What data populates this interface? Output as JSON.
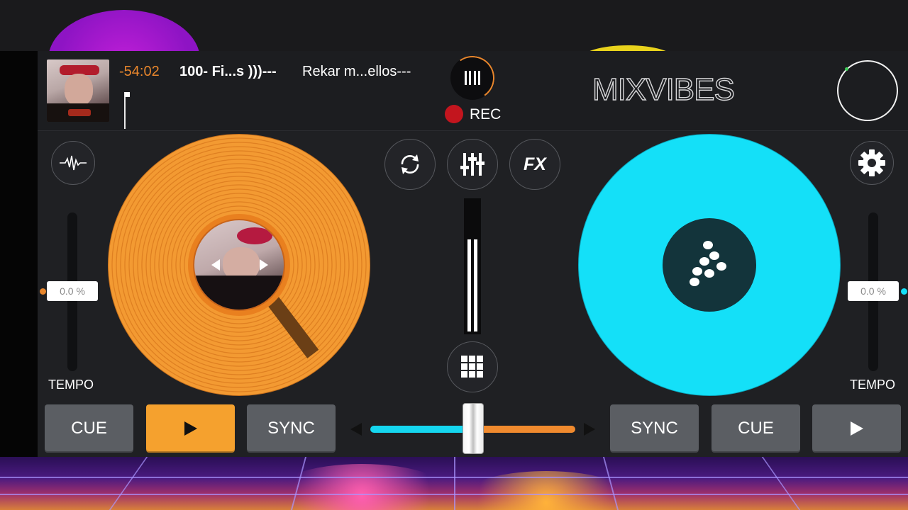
{
  "deck_a": {
    "time_remaining": "-54:02",
    "track_title": "100- Fi...s )))---",
    "track_artist": "Rekar m...ellos---",
    "tempo_value": "0.0 %",
    "tempo_label": "TEMPO",
    "platter_color": "#f39a32",
    "accent": "#e8862c"
  },
  "deck_b": {
    "tempo_value": "0.0 %",
    "tempo_label": "TEMPO",
    "platter_color": "#14e0f8",
    "accent": "#14e0f8"
  },
  "header": {
    "brand": "MIXVIBES",
    "rec_label": "REC",
    "rec_color": "#c3151e"
  },
  "center_controls": {
    "fx_label": "FX",
    "icons": [
      "sync-loop-icon",
      "equalizer-sliders-icon",
      "fx-button",
      "sampler-grid-icon"
    ]
  },
  "transport": {
    "left": {
      "cue_label": "CUE",
      "sync_label": "SYNC",
      "play_active": true
    },
    "right": {
      "cue_label": "CUE",
      "sync_label": "SYNC",
      "play_active": false
    }
  },
  "crossfader": {
    "position": 0.5,
    "left_color": "#15d6ef",
    "right_color": "#f08a2e"
  },
  "icons": {
    "deck_a_waveform": "waveform-icon",
    "deck_b_settings": "gear-icon",
    "mixer": "mixer-bars-icon",
    "master_knob": "master-volume-knob"
  }
}
